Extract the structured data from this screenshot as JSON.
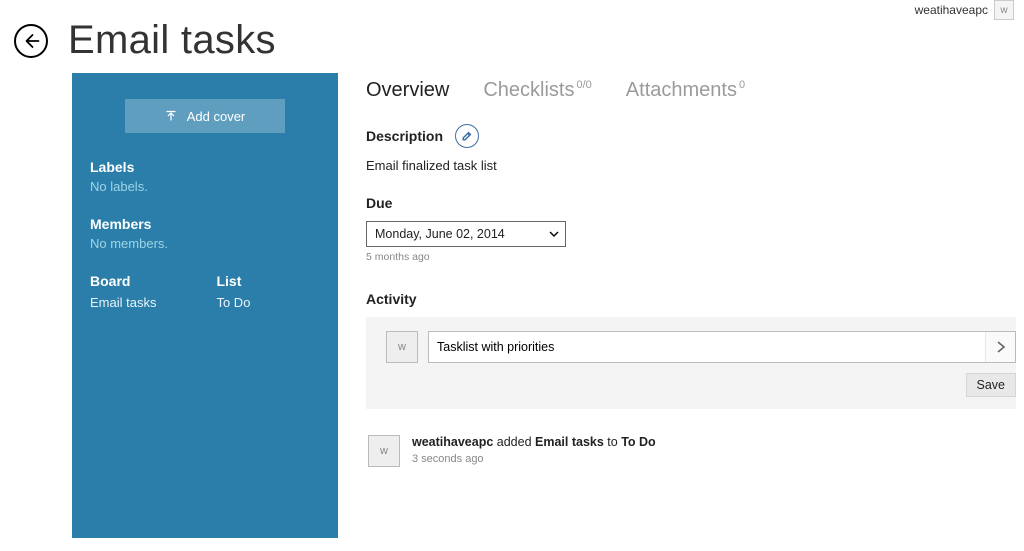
{
  "user": {
    "name": "weatihaveapc",
    "initial": "w"
  },
  "header": {
    "title": "Email tasks"
  },
  "sidebar": {
    "add_cover_label": "Add cover",
    "labels_heading": "Labels",
    "labels_empty": "No labels.",
    "members_heading": "Members",
    "members_empty": "No members.",
    "board_heading": "Board",
    "board_value": "Email tasks",
    "list_heading": "List",
    "list_value": "To Do"
  },
  "tabs": {
    "overview": "Overview",
    "checklists": "Checklists",
    "checklists_count": "0/0",
    "attachments": "Attachments",
    "attachments_count": "0"
  },
  "description": {
    "heading": "Description",
    "text": "Email finalized task list"
  },
  "due": {
    "heading": "Due",
    "value": "Monday, June 02, 2014",
    "relative": "5 months ago"
  },
  "activity": {
    "heading": "Activity",
    "avatar_initial": "w",
    "input_value": "Tasklist with priorities",
    "save_label": "Save"
  },
  "log": {
    "avatar_initial": "w",
    "actor": "weatihaveapc",
    "verb": " added ",
    "object": "Email tasks",
    "preposition": " to ",
    "target": "To Do",
    "time": "3 seconds ago"
  }
}
